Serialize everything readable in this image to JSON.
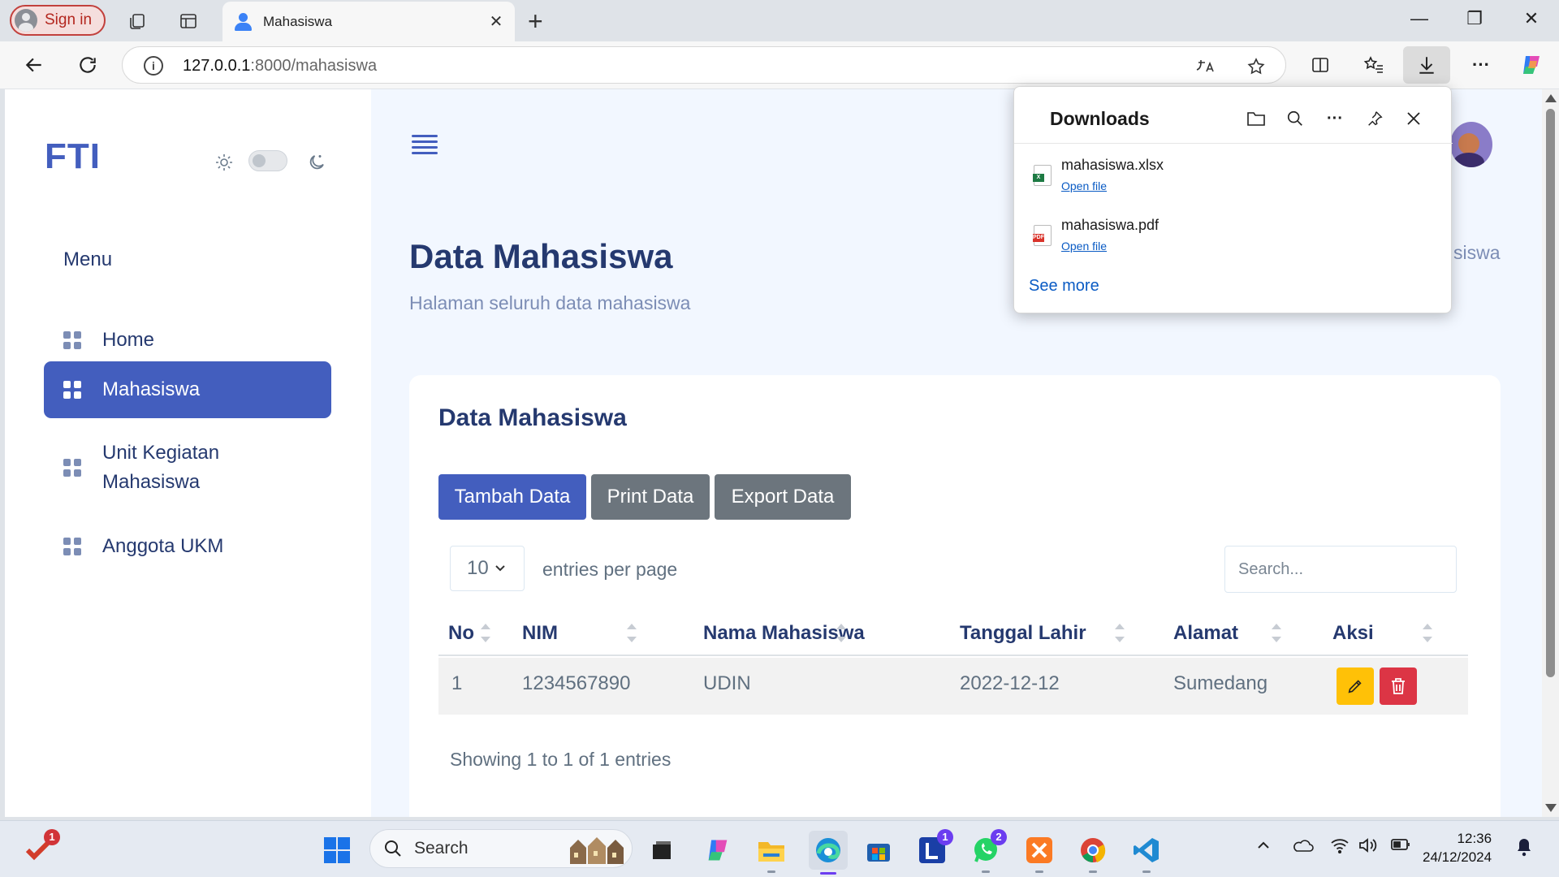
{
  "browser": {
    "signin_label": "Sign in",
    "tab_title": "Mahasiswa",
    "tab_close": "✕",
    "new_tab": "+",
    "url_host": "127.0.0.1",
    "url_rest": ":8000/mahasiswa",
    "window_controls": {
      "minimize": "—",
      "restore": "❐",
      "close": "✕"
    }
  },
  "sidebar": {
    "logo": "FTI",
    "menu_title": "Menu",
    "items": [
      {
        "label": "Home",
        "active": false
      },
      {
        "label": "Mahasiswa",
        "active": true
      },
      {
        "label": "Unit Kegiatan Mahasiswa",
        "active": false
      },
      {
        "label": "Anggota UKM",
        "active": false
      }
    ]
  },
  "page": {
    "title": "Data Mahasiswa",
    "subtitle": "Halaman seluruh data mahasiswa",
    "breadcrumb_partial": "siswa"
  },
  "card": {
    "title": "Data Mahasiswa",
    "buttons": {
      "add": "Tambah Data",
      "print": "Print Data",
      "export": "Export Data"
    },
    "per_page_value": "10",
    "per_page_label": "entries per page",
    "search_placeholder": "Search...",
    "columns": [
      "No",
      "NIM",
      "Nama Mahasiswa",
      "Tanggal Lahir",
      "Alamat",
      "Aksi"
    ],
    "rows": [
      {
        "no": "1",
        "nim": "1234567890",
        "nama": "UDIN",
        "tanggal_lahir": "2022-12-12",
        "alamat": "Sumedang"
      }
    ],
    "footer": "Showing 1 to 1 of 1 entries"
  },
  "downloads": {
    "title": "Downloads",
    "items": [
      {
        "name": "mahasiswa.xlsx",
        "action": "Open file",
        "type": "xlsx"
      },
      {
        "name": "mahasiswa.pdf",
        "action": "Open file",
        "type": "pdf"
      }
    ],
    "see_more": "See more"
  },
  "taskbar": {
    "search_label": "Search",
    "badges": {
      "todo": "1",
      "lens": "1",
      "whatsapp": "2"
    },
    "time": "12:36",
    "date": "24/12/2024"
  },
  "colors": {
    "primary": "#435ebe",
    "secondary": "#6c757d",
    "warning": "#ffc107",
    "danger": "#dc3545",
    "heading": "#25396f",
    "page_bg": "#f2f7ff"
  }
}
